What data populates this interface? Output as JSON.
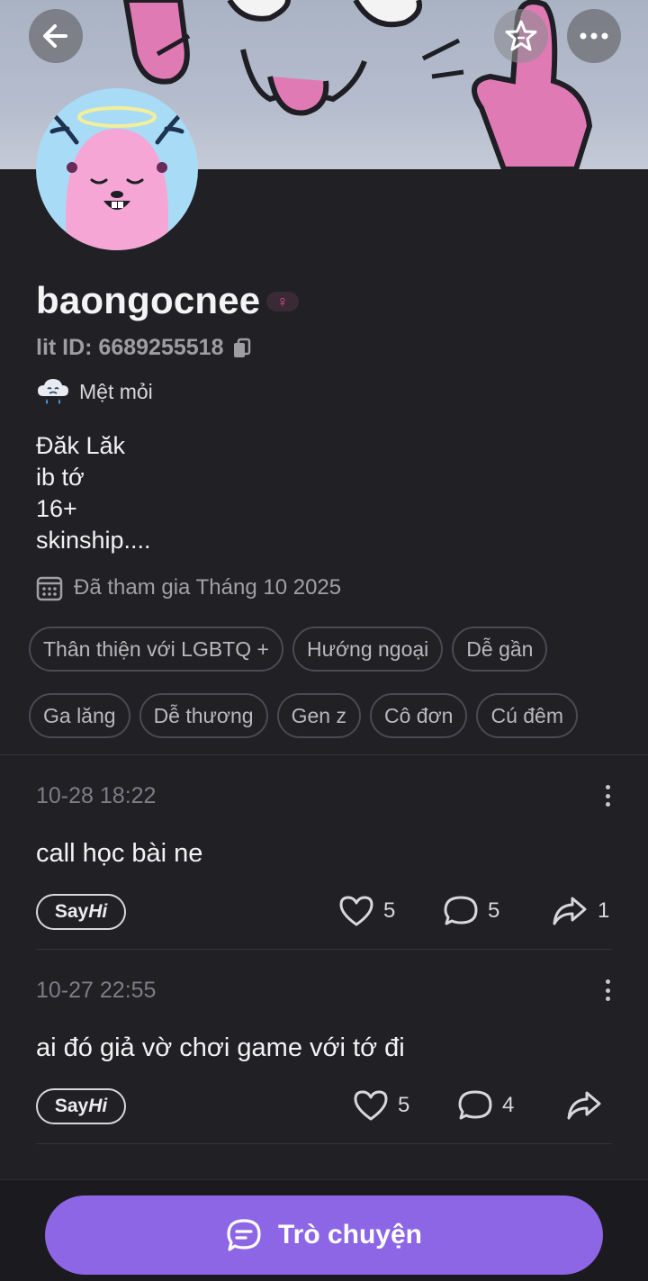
{
  "profile": {
    "username": "baongocnee",
    "lit_id": "lit ID: 6689255518",
    "mood": "Mệt mỏi",
    "bio": [
      "Đăk Lăk",
      "ib tớ",
      "16+",
      "skinship...."
    ],
    "joined": "Đã tham gia Tháng 10 2025",
    "gender_symbol": "♀"
  },
  "tags_row1": [
    "Thân thiện với LGBTQ +",
    "Hướng ngoại",
    "Dễ gần"
  ],
  "tags_row2": [
    "Ga lăng",
    "Dễ thương",
    "Gen z",
    "Cô đơn",
    "Cú đêm"
  ],
  "posts": [
    {
      "time": "10-28 18:22",
      "text": "call học bài ne",
      "sayhi": "Say",
      "sayhi_italic": "Hi",
      "likes": "5",
      "comments": "5",
      "shares": "1"
    },
    {
      "time": "10-27 22:55",
      "text": "ai đó giả vờ chơi game với tớ đi",
      "sayhi": "Say",
      "sayhi_italic": "Hi",
      "likes": "5",
      "comments": "4",
      "shares": ""
    }
  ],
  "chat_button": "Trò chuyện",
  "colors": {
    "accent": "#8d66e6",
    "background": "#212025",
    "gender_pink": "#e0508a"
  },
  "icons": [
    "back-arrow-icon",
    "star-icon",
    "more-icon",
    "copy-icon",
    "mood-cloud-icon",
    "calendar-icon",
    "heart-icon",
    "comment-icon",
    "share-icon",
    "chat-icon"
  ]
}
